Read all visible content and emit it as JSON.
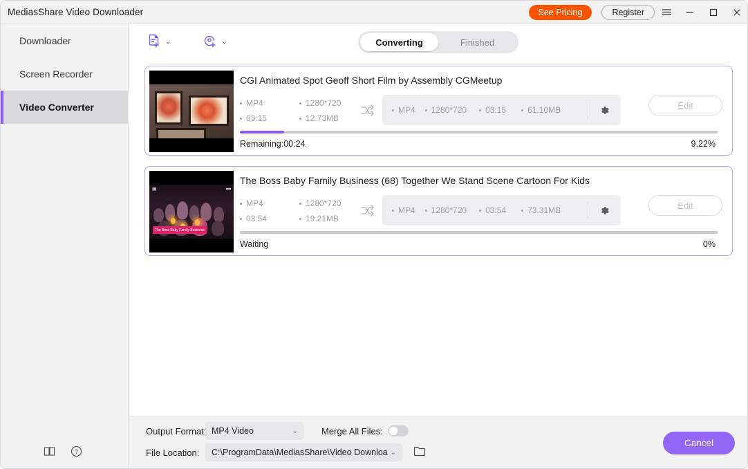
{
  "window": {
    "title": "MediasShare Video Downloader",
    "see_pricing_label": "See Pricing",
    "register_label": "Register",
    "menu_icon": "hamburger-menu-icon",
    "minimize_icon": "minimize-icon",
    "maximize_icon": "maximize-icon",
    "close_icon": "close-icon"
  },
  "sidebar": {
    "items": [
      {
        "label": "Downloader",
        "active": false
      },
      {
        "label": "Screen Recorder",
        "active": false
      },
      {
        "label": "Video Converter",
        "active": true
      }
    ],
    "bottom_icons": [
      {
        "name": "manual-book-icon"
      },
      {
        "name": "help-circle-icon"
      }
    ]
  },
  "toolbar": {
    "add_file_icon": "add-file-icon",
    "add_disc_icon": "add-disc-icon",
    "chevron": "⌄",
    "tabs": [
      {
        "label": "Converting",
        "active": true
      },
      {
        "label": "Finished",
        "active": false
      }
    ]
  },
  "tasks": [
    {
      "title": "CGI Animated Spot Geoff Short Film by Assembly  CGMeetup",
      "source": {
        "format": "MP4",
        "resolution": "1280*720",
        "duration": "03:15",
        "size": "12.73MB"
      },
      "output": {
        "format": "MP4",
        "resolution": "1280*720",
        "duration": "03:15",
        "size": "61.10MB"
      },
      "edit_label": "Edit",
      "status": "Remaining:00:24",
      "percent_label": "9.22%",
      "percent_value": 9.22,
      "thumbnail": "framed-artwork-scene"
    },
    {
      "title": "The Boss Baby Family Business (68)  Together We Stand Scene  Cartoon For Kids",
      "source": {
        "format": "MP4",
        "resolution": "1280*720",
        "duration": "03:54",
        "size": "19.21MB"
      },
      "output": {
        "format": "MP4",
        "resolution": "1280*720",
        "duration": "03:54",
        "size": "73.31MB"
      },
      "edit_label": "Edit",
      "status": "Waiting",
      "percent_label": "0%",
      "percent_value": 0,
      "thumbnail": "theater-audience-scene",
      "thumbnail_banner": "The Boss Baby Family Business"
    }
  ],
  "bottom": {
    "output_format_label": "Output Format:",
    "output_format_value": "MP4 Video",
    "merge_label": "Merge All Files:",
    "merge_enabled": false,
    "file_location_label": "File Location:",
    "file_location_value": "C:\\ProgramData\\MediasShare\\Video Downloa",
    "folder_icon": "folder-icon",
    "cancel_label": "Cancel"
  },
  "colors": {
    "accent_purple": "#8b5cf6",
    "cancel_purple": "#9466f5",
    "pricing_orange": "#fa5400",
    "card_border": "#b9a3f5"
  }
}
